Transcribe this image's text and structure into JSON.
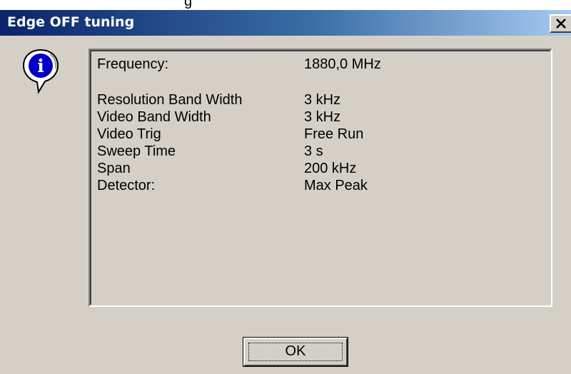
{
  "top_strip": {
    "clipped_text": "g"
  },
  "window": {
    "title": "Edge OFF tuning",
    "close_icon": "close-icon"
  },
  "info_icon": {
    "icon": "info-balloon-icon",
    "glyph": "i"
  },
  "info": {
    "rows": [
      {
        "label": "Frequency:",
        "value": "1880,0 MHz"
      },
      {
        "label": "Resolution Band Width",
        "value": "3 kHz"
      },
      {
        "label": "Video Band Width",
        "value": "3 kHz"
      },
      {
        "label": "Video Trig",
        "value": "Free Run"
      },
      {
        "label": "Sweep Time",
        "value": "3 s"
      },
      {
        "label": "Span",
        "value": "200 kHz"
      },
      {
        "label": "Detector:",
        "value": "Max Peak"
      }
    ]
  },
  "buttons": {
    "ok_label": "OK"
  },
  "colors": {
    "title_gradient_start": "#0a246a",
    "title_gradient_end": "#a6caf0",
    "dialog_face": "#d4d0c8",
    "info_icon_blue": "#0000c8"
  }
}
